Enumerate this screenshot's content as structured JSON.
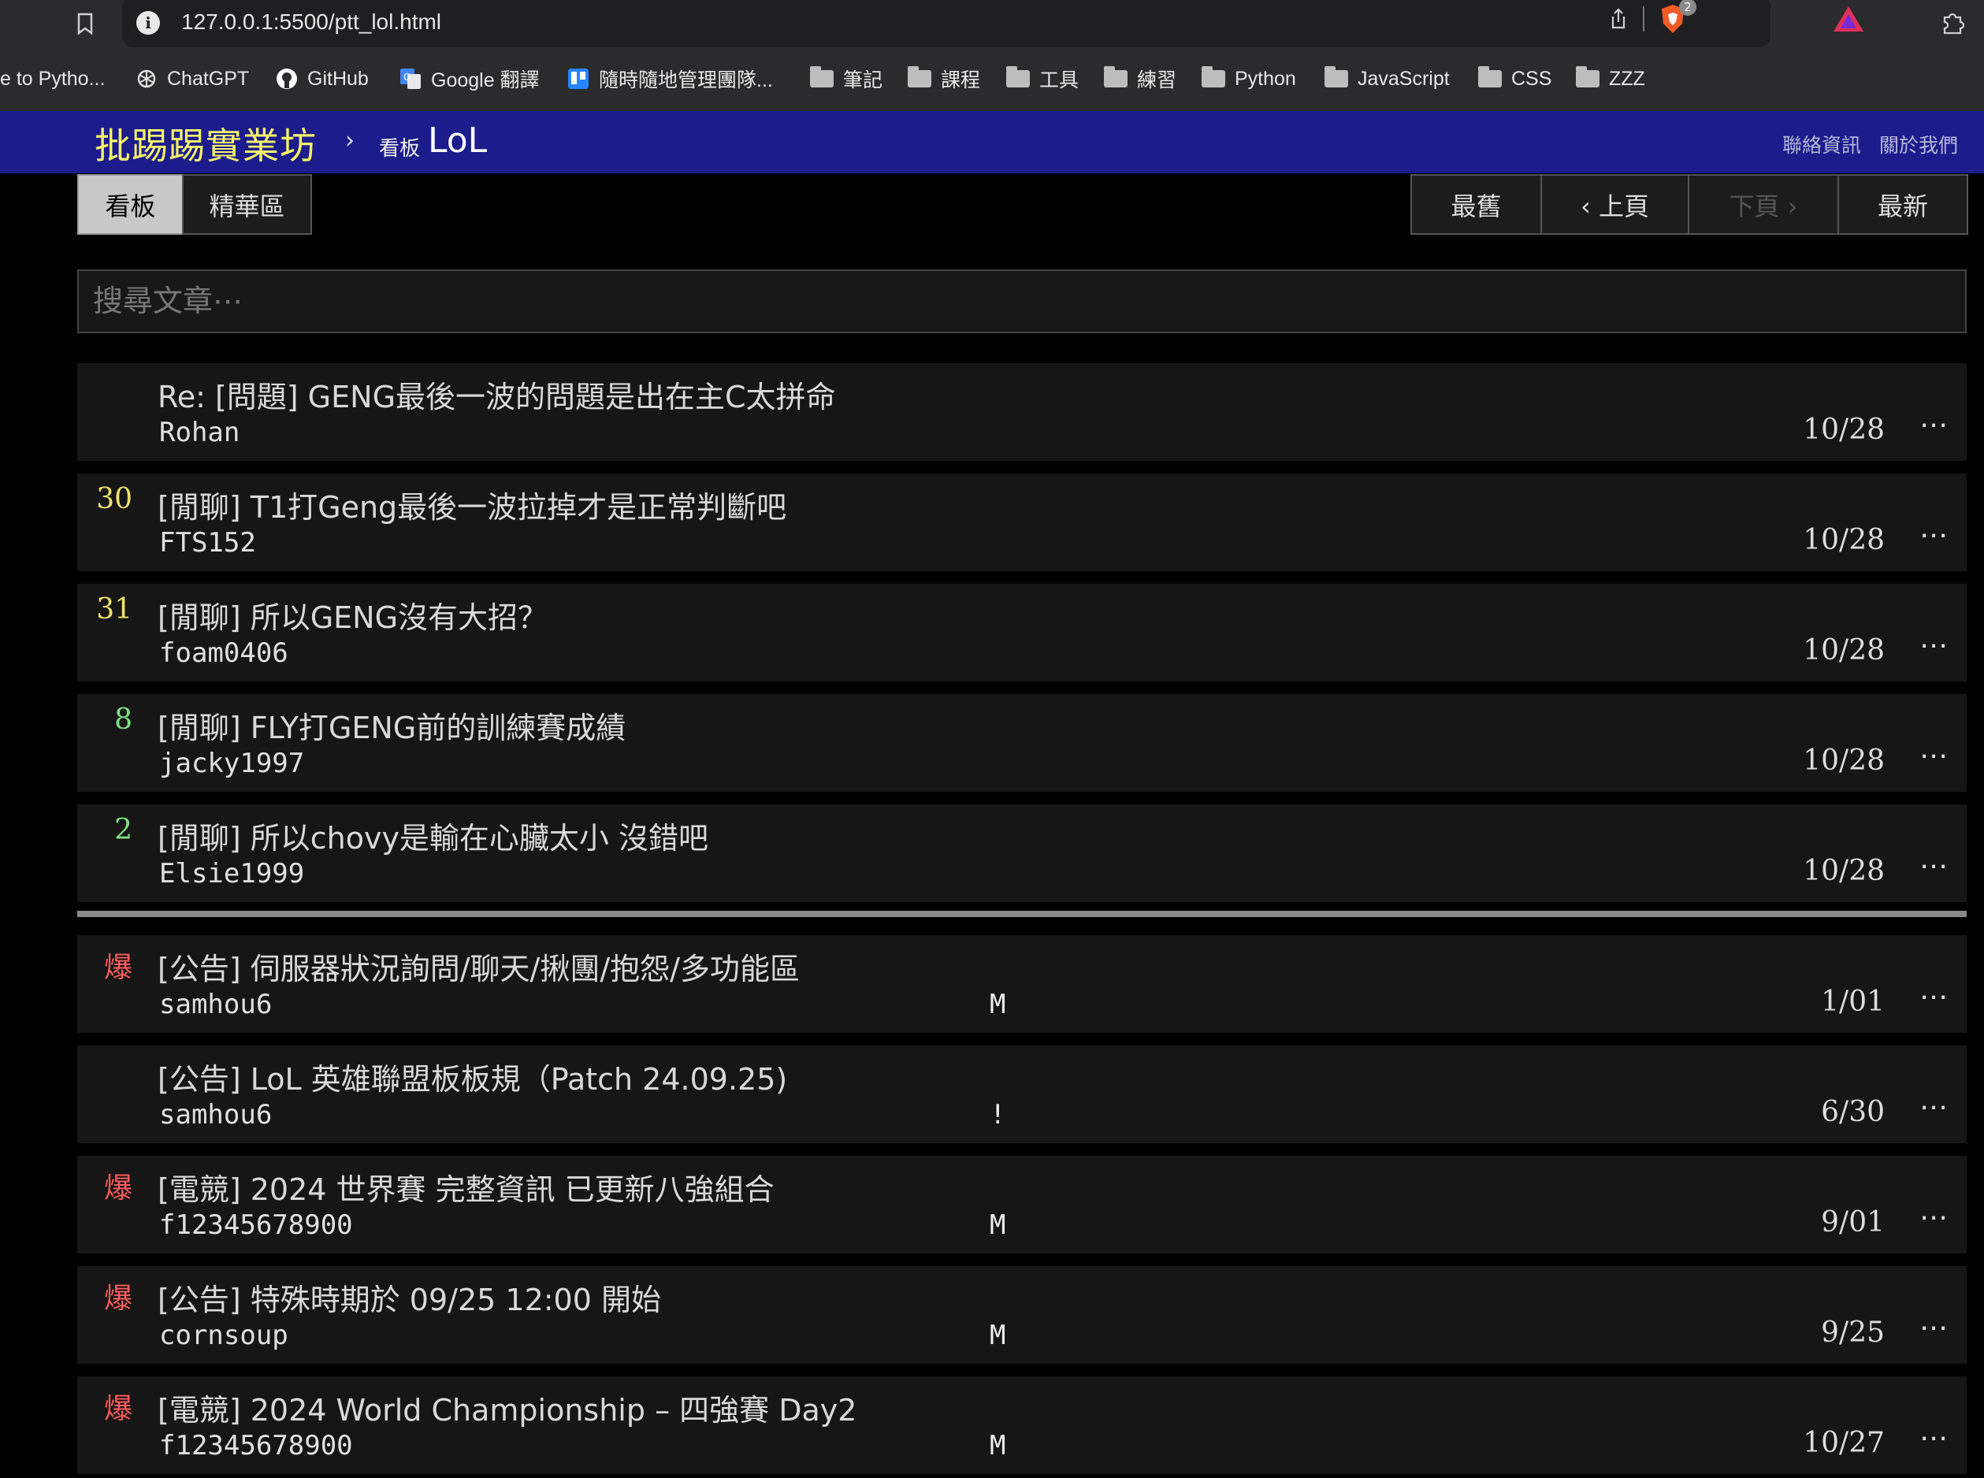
{
  "browser": {
    "url": "127.0.0.1:5500/ptt_lol.html",
    "brave_badge": "2",
    "bookmarks": [
      {
        "label": "e to Pytho...",
        "icon": "none"
      },
      {
        "label": "ChatGPT",
        "icon": "chatgpt-icon"
      },
      {
        "label": "GitHub",
        "icon": "github-icon"
      },
      {
        "label": "Google 翻譯",
        "icon": "google-translate-icon"
      },
      {
        "label": "隨時隨地管理團隊...",
        "icon": "trello-icon"
      },
      {
        "label": "筆記",
        "icon": "folder-icon"
      },
      {
        "label": "課程",
        "icon": "folder-icon"
      },
      {
        "label": "工具",
        "icon": "folder-icon"
      },
      {
        "label": "練習",
        "icon": "folder-icon"
      },
      {
        "label": "Python",
        "icon": "folder-icon"
      },
      {
        "label": "JavaScript",
        "icon": "folder-icon"
      },
      {
        "label": "CSS",
        "icon": "folder-icon"
      },
      {
        "label": "ZZZ",
        "icon": "folder-icon"
      }
    ]
  },
  "header": {
    "site_title": "批踢踢實業坊",
    "crumb_arrow": "›",
    "crumb_label": "看板",
    "board_name": "LoL",
    "links": [
      "聯絡資訊",
      "關於我們"
    ]
  },
  "tabs": [
    "看板",
    "精華區"
  ],
  "pager": [
    "最舊",
    "‹ 上頁",
    "下頁 ›",
    "最新"
  ],
  "search": {
    "placeholder": "搜尋文章⋯"
  },
  "colors": {
    "topbar": "#1c1c8c",
    "title": "#f5f36a",
    "bao": "#ff5c5c",
    "rec_yellow": "#f0e36a",
    "rec_green": "#7ee27e"
  },
  "posts": [
    {
      "nrec": "",
      "title": "Re: [問題] GENG最後一波的問題是出在主C太拼命",
      "author": "Rohan",
      "mark": "",
      "date": "10/28"
    },
    {
      "nrec": "30",
      "title": "[閒聊] T1打Geng最後一波拉掉才是正常判斷吧",
      "author": "FTS152",
      "mark": "",
      "date": "10/28"
    },
    {
      "nrec": "31",
      "title": "[閒聊] 所以GENG沒有大招？",
      "author": "foam0406",
      "mark": "",
      "date": "10/28"
    },
    {
      "nrec": "8",
      "title": "[閒聊] FLY打GENG前的訓練賽成績",
      "author": "jacky1997",
      "mark": "",
      "date": "10/28"
    },
    {
      "nrec": "2",
      "title": "[閒聊] 所以chovy是輸在心臟太小 沒錯吧",
      "author": "Elsie1999",
      "mark": "",
      "date": "10/28"
    }
  ],
  "pinned": [
    {
      "nrec": "爆",
      "title": "[公告] 伺服器狀況詢問/聊天/揪團/抱怨/多功能區",
      "author": "samhou6",
      "mark": "M",
      "date": "1/01"
    },
    {
      "nrec": "",
      "title": "[公告] LoL 英雄聯盟板板規（Patch 24.09.25)",
      "author": "samhou6",
      "mark": "!",
      "date": "6/30"
    },
    {
      "nrec": "爆",
      "title": "[電競] 2024 世界賽 完整資訊 已更新八強組合",
      "author": "f12345678900",
      "mark": "M",
      "date": "9/01"
    },
    {
      "nrec": "爆",
      "title": "[公告] 特殊時期於 09/25 12:00 開始",
      "author": "cornsoup",
      "mark": "M",
      "date": "9/25"
    },
    {
      "nrec": "爆",
      "title": "[電競] 2024 World Championship – 四強賽 Day2",
      "author": "f12345678900",
      "mark": "M",
      "date": "10/27"
    }
  ],
  "more_label": "⋯"
}
